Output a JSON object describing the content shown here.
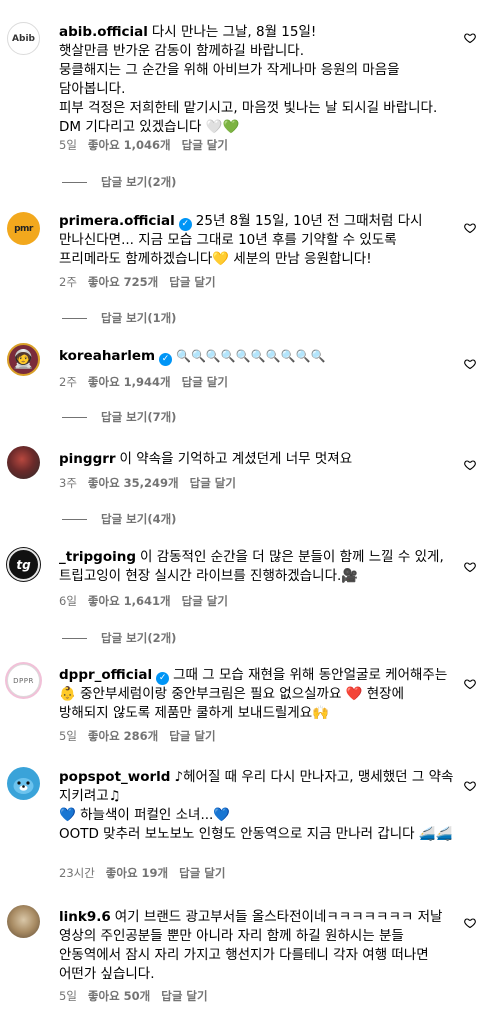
{
  "comments": [
    {
      "username": "abib.official",
      "verified": false,
      "text": "다시 만나는 그날, 8월 15일!\n햇살만큼 반가운 감동이 함께하길 바랍니다.\n뭉클해지는 그 순간을 위해 아비브가 작게나마 응원의 마음을 담아봅니다.\n피부 걱정은 저희한테 맡기시고, 마음껏 빛나는 날 되시길 바랍니다.\nDM 기다리고 있겠습니다 🤍💚",
      "time": "5일",
      "likes": "좋아요 1,046개",
      "reply": "답글 달기",
      "view_replies": "답글 보기(2개)",
      "avatar_text": "Abib"
    },
    {
      "username": "primera.official",
      "verified": true,
      "text": "25년 8월 15일, 10년 전 그때처럼 다시 만나신다면... 지금 모습 그대로 10년 후를 기약할 수 있도록 프리메라도 함께하겠습니다💛 세분의 만남 응원합니다!",
      "time": "2주",
      "likes": "좋아요 725개",
      "reply": "답글 달기",
      "view_replies": "답글 보기(1개)",
      "avatar_text": "pmr"
    },
    {
      "username": "koreaharlem",
      "verified": true,
      "text": "🔍🔍🔍🔍🔍🔍🔍🔍🔍🔍",
      "time": "2주",
      "likes": "좋아요 1,944개",
      "reply": "답글 달기",
      "view_replies": "답글 보기(7개)",
      "avatar_text": "🧑‍🚀"
    },
    {
      "username": "pinggrr",
      "verified": false,
      "text": "이 약속을 기억하고 계셨던게 너무 멋져요",
      "time": "3주",
      "likes": "좋아요 35,249개",
      "reply": "답글 달기",
      "view_replies": "답글 보기(4개)",
      "avatar_text": ""
    },
    {
      "username": "_tripgoing",
      "verified": false,
      "text": "이 감동적인 순간을 더 많은 분들이 함께 느낄 수 있게, 트립고잉이 현장 실시간 라이브를 진행하겠습니다.🎥",
      "time": "6일",
      "likes": "좋아요 1,641개",
      "reply": "답글 달기",
      "view_replies": "답글 보기(2개)",
      "avatar_text": "tg"
    },
    {
      "username": "dppr_official",
      "verified": true,
      "text": "그때 그 모습 재현을 위해 동안얼굴로 케어해주는 👶 중안부세럼이랑 중안부크림은 필요 없으실까요 ❤️ 현장에 방해되지 않도록 제품만 쿨하게 보내드릴게요🙌",
      "time": "5일",
      "likes": "좋아요 286개",
      "reply": "답글 달기",
      "view_replies": "",
      "avatar_text": "DPPR"
    },
    {
      "username": "popspot_world",
      "verified": false,
      "text": "♪헤어질 때 우리 다시 만나자고, 맹세했던 그 약속 지키려고♫\n💙 하늘색이 퍼컬인 소녀...💙\nOOTD 맞추러 보노보노 인형도 안동역으로 지금 만나러 갑니다 🚄🚄",
      "time": "23시간",
      "likes": "좋아요 19개",
      "reply": "답글 달기",
      "view_replies": "",
      "avatar_text": ""
    },
    {
      "username": "link9.6",
      "verified": false,
      "text": "여기 브랜드 광고부서들 올스타전이네ㅋㅋㅋㅋㅋㅋㅋ 저날 영상의 주인공분들 뿐만 아니라 자리 함께 하길 원하시는 분들 안동역에서 잠시 자리 가지고 행선지가 다를테니 각자 여행 떠나면 어떤가 싶습니다.",
      "time": "5일",
      "likes": "좋아요 50개",
      "reply": "답글 달기",
      "view_replies": "",
      "avatar_text": ""
    }
  ],
  "colors": {
    "text": "#000000",
    "muted": "#737373",
    "verified": "#0095f6"
  }
}
